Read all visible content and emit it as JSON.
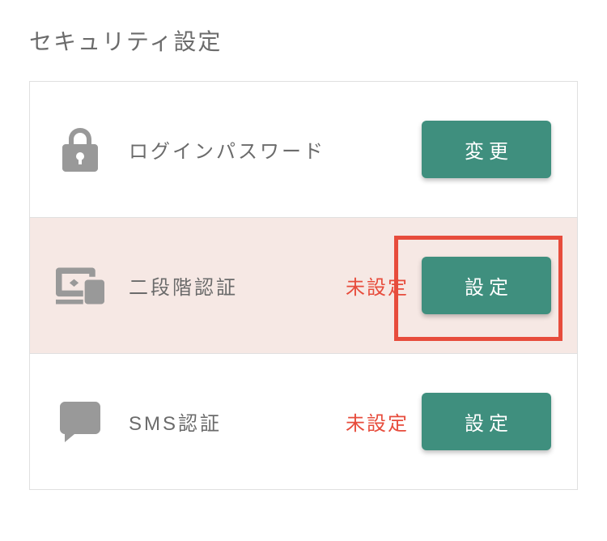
{
  "title": "セキュリティ設定",
  "rows": [
    {
      "icon": "lock-icon",
      "label": "ログインパスワード",
      "status": "",
      "button": "変更",
      "highlighted": false
    },
    {
      "icon": "devices-icon",
      "label": "二段階認証",
      "status": "未設定",
      "button": "設定",
      "highlighted": true
    },
    {
      "icon": "sms-icon",
      "label": "SMS認証",
      "status": "未設定",
      "button": "設定",
      "highlighted": false
    }
  ]
}
